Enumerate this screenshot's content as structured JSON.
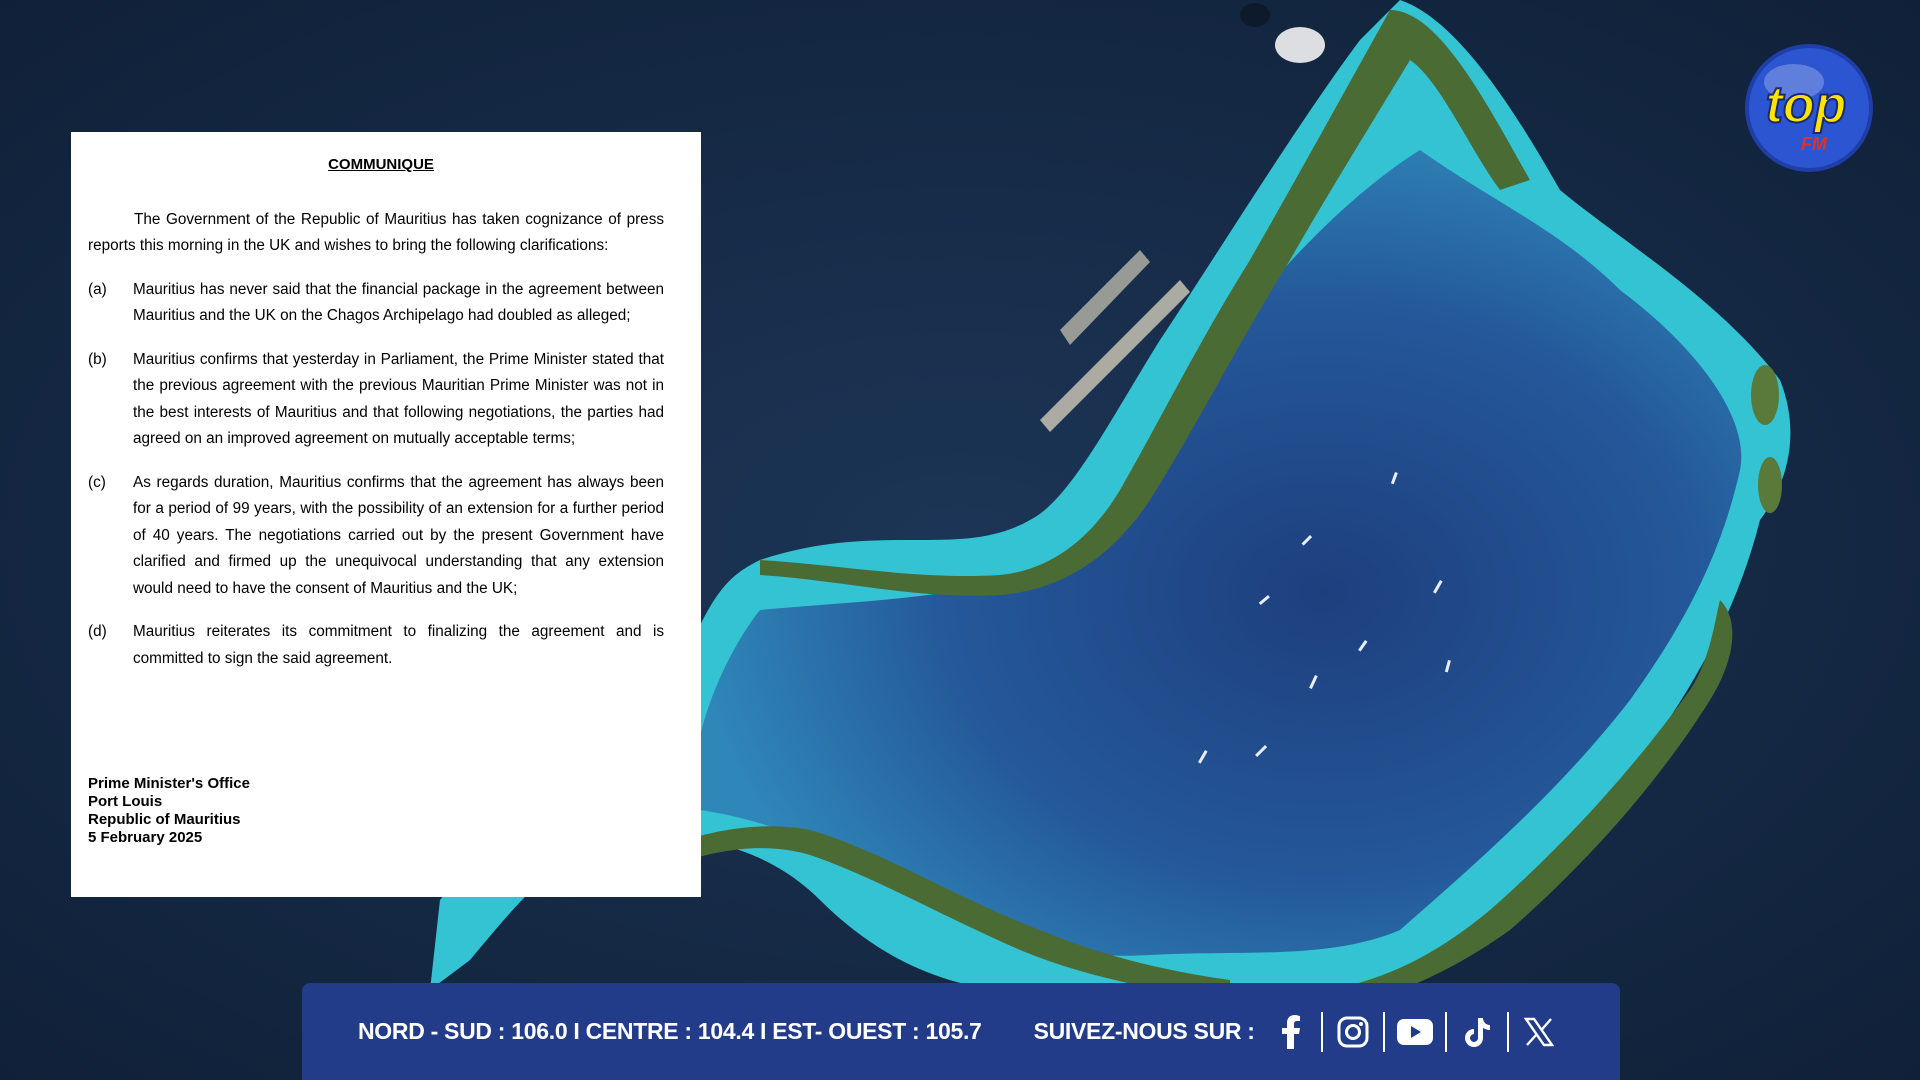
{
  "communique": {
    "title": "COMMUNIQUE",
    "intro": "The Government of the Republic of Mauritius has taken cognizance of press reports this morning in the UK and wishes to bring the following clarifications:",
    "items": [
      {
        "letter": "(a)",
        "text": "Mauritius has never said that the financial package in the agreement between Mauritius and the UK on the Chagos Archipelago had doubled as alleged;"
      },
      {
        "letter": "(b)",
        "text": "Mauritius confirms that yesterday in Parliament, the Prime Minister stated that the previous agreement with the previous Mauritian Prime Minister was not in the best interests of Mauritius and that following negotiations, the parties had agreed on an improved agreement on mutually acceptable terms;"
      },
      {
        "letter": "(c)",
        "text": "As regards duration, Mauritius confirms that the agreement has always been for a period of 99 years, with the possibility of an extension for a further period of 40 years.  The negotiations carried out by the present Government have clarified and firmed up the unequivocal understanding that any extension would need to have the consent of Mauritius and the UK;"
      },
      {
        "letter": "(d)",
        "text": "Mauritius reiterates its commitment to finalizing the agreement and is committed to sign the said agreement."
      }
    ],
    "signature": {
      "line1": "Prime Minister's Office",
      "line2": "Port Louis",
      "line3": "Republic of Mauritius",
      "line4": "5 February 2025"
    }
  },
  "logo": {
    "text": "top",
    "sub": "FM"
  },
  "footer": {
    "frequencies": "NORD - SUD : 106.0  I  CENTRE : 104.4  I  EST- OUEST : 105.7",
    "follow_label": "SUIVEZ-NOUS SUR :",
    "socials": [
      "facebook-icon",
      "instagram-icon",
      "youtube-icon",
      "tiktok-icon",
      "x-icon"
    ]
  },
  "colors": {
    "footer_bg": "#233c8a",
    "ocean": "#13253f",
    "lagoon": "#2a6fa6",
    "reef": "#3fc1d0",
    "land": "#3e5a2c",
    "logo_yellow": "#ffe400",
    "logo_blue": "#1f3ea8",
    "logo_red": "#e0302a"
  }
}
